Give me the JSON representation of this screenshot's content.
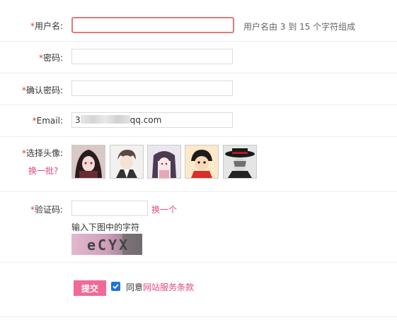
{
  "required_mark": "*",
  "username": {
    "label": "用户名:",
    "value": "",
    "hint": "用户名由 3 到 15 个字符组成"
  },
  "password": {
    "label": "密码:",
    "value": ""
  },
  "confirm_password": {
    "label": "确认密码:",
    "value": ""
  },
  "email": {
    "label": "Email:",
    "value": "3████████████████████████qq.com"
  },
  "avatar": {
    "label": "选择头像:",
    "refresh_link": "换一批?",
    "options": [
      "avatar-1",
      "avatar-2",
      "avatar-3",
      "avatar-4",
      "avatar-5"
    ]
  },
  "captcha": {
    "label": "验证码:",
    "value": "",
    "refresh_link": "换一个",
    "instruction": "输入下图中的字符",
    "image_text": "eCYX"
  },
  "submit": {
    "label": "提交"
  },
  "agree": {
    "checked": true,
    "prefix": "同意",
    "link": "网站服务条款"
  },
  "colors": {
    "accent": "#f06a99",
    "link": "#e8467c",
    "required": "#e53935",
    "focus_border": "#e07a7a",
    "checkbox": "#1e73d8"
  }
}
